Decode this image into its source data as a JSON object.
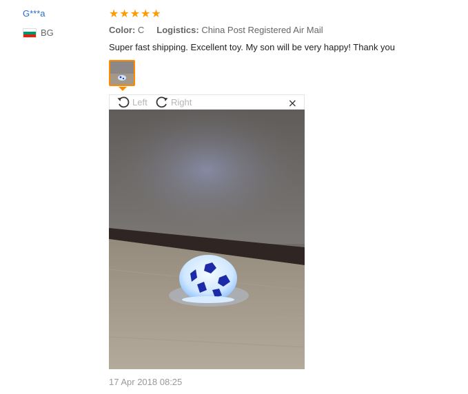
{
  "reviewer": {
    "name": "G***a",
    "country_code": "BG",
    "flag_colors": [
      "#ffffff",
      "#00966e",
      "#d62612"
    ]
  },
  "rating": {
    "stars": 5,
    "max": 5,
    "star_glyph": "★",
    "color": "#ff9a00"
  },
  "attributes": {
    "color_label": "Color:",
    "color_value": "C",
    "logistics_label": "Logistics:",
    "logistics_value": "China Post Registered Air Mail"
  },
  "review": {
    "text": "Super fast shipping. Excellent toy. My son will be very happy! Thank you",
    "date": "17 Apr 2018 08:25"
  },
  "viewer": {
    "rotate_left_label": "Left",
    "rotate_right_label": "Right",
    "close_glyph": "×",
    "rotate_left_icon": "rotate-ccw-icon",
    "rotate_right_icon": "rotate-cw-icon",
    "close_icon": "close-icon"
  },
  "colors": {
    "accent": "#ff8a00",
    "link": "#2a6bc7"
  }
}
